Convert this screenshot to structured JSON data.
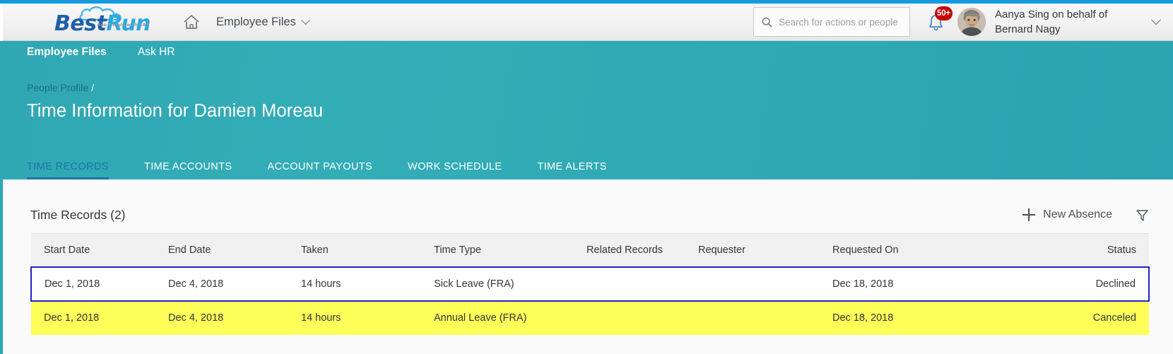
{
  "header": {
    "logo": {
      "first": "Best",
      "second": "Run",
      "tagline": "Run simple with SAP"
    },
    "home_icon": "home-icon",
    "app_menu_label": "Employee Files",
    "search": {
      "placeholder": "Search for actions or people",
      "value": "",
      "icon": "search-icon"
    },
    "notifications": {
      "icon": "bell-icon",
      "badge": "50+"
    },
    "user": {
      "name": "Aanya Sing on behalf of Bernard Nagy",
      "avatar": "user-avatar"
    }
  },
  "subnav": {
    "items": [
      {
        "label": "Employee Files",
        "active": true
      },
      {
        "label": "Ask HR",
        "active": false
      }
    ]
  },
  "breadcrumb": {
    "parent": "People Profile",
    "separator": "/"
  },
  "page_title": "Time Information for Damien Moreau",
  "tabs": [
    {
      "label": "TIME RECORDS",
      "active": true
    },
    {
      "label": "TIME ACCOUNTS",
      "active": false
    },
    {
      "label": "ACCOUNT PAYOUTS",
      "active": false
    },
    {
      "label": "WORK SCHEDULE",
      "active": false
    },
    {
      "label": "TIME ALERTS",
      "active": false
    }
  ],
  "card": {
    "title": "Time Records (2)",
    "new_absence_label": "New Absence",
    "filter_icon": "filter-icon",
    "plus_icon": "plus-icon"
  },
  "table": {
    "columns": [
      "Start Date",
      "End Date",
      "Taken",
      "Time Type",
      "Related Records",
      "Requester",
      "Requested On",
      "Status"
    ],
    "rows": [
      {
        "start_date": "Dec 1, 2018",
        "end_date": "Dec 4, 2018",
        "taken": "14 hours",
        "time_type": "Sick Leave (FRA)",
        "related_records": "",
        "requester": "",
        "requested_on": "Dec 18, 2018",
        "status": "Declined",
        "state": "selected",
        "status_style": "declined"
      },
      {
        "start_date": "Dec 1, 2018",
        "end_date": "Dec 4, 2018",
        "taken": "14 hours",
        "time_type": "Annual Leave (FRA)",
        "related_records": "",
        "requester": "",
        "requested_on": "Dec 18, 2018",
        "status": "Canceled",
        "state": "highlight",
        "status_style": "canceled"
      }
    ]
  },
  "colors": {
    "accent_blue": "#159ae0",
    "teal": "#2ea8b3",
    "tab_active": "#1c74a8",
    "breadcrumb_link": "#1c6f87",
    "badge_red": "#c70000",
    "status_declined": "#cc0000",
    "status_canceled": "#5b6066",
    "row_highlight": "#ffff5a",
    "row_selected_border": "#2222cc"
  }
}
